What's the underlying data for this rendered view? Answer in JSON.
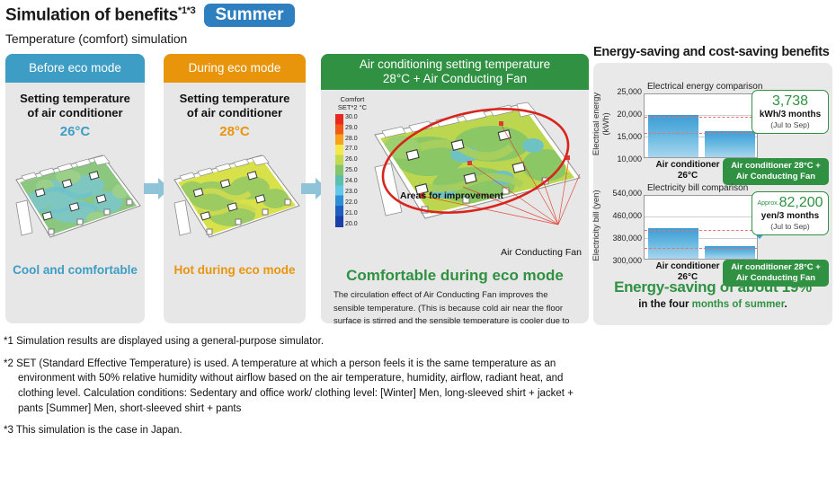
{
  "header": {
    "title": "Simulation of benefits",
    "title_sup": "*1*3",
    "badge": "Summer",
    "subtitle": "Temperature (comfort) simulation"
  },
  "panels": {
    "before": {
      "head": "Before eco mode",
      "set_label": "Setting temperature\nof air conditioner",
      "set_label_line1": "Setting temperature",
      "set_label_line2": "of air conditioner",
      "temp": "26°C",
      "message": "Cool and comfortable",
      "accent": "#3e9dc4"
    },
    "during": {
      "head": "During eco mode",
      "set_label_line1": "Setting temperature",
      "set_label_line2": "of air conditioner",
      "temp": "28°C",
      "message": "Hot during eco mode",
      "accent": "#e8950c"
    },
    "fan": {
      "head_line1": "Air conditioning setting temperature",
      "head_line2": "28°C + Air Conducting Fan",
      "scale_title_line1": "Comfort",
      "scale_title_line2": "SET*2 °C",
      "scale_ticks": [
        "30.0",
        "29.0",
        "28.0",
        "27.0",
        "26.0",
        "25.0",
        "24.0",
        "23.0",
        "22.0",
        "21.0",
        "20.0"
      ],
      "areas_label": "Areas for improvement",
      "fan_caption": "Air Conducting Fan",
      "headline": "Comfortable during eco mode",
      "description": "The circulation effect of Air Conducting Fan improves the sensible temperature. (This is because cold air near the floor surface is stirred and the sensible temperature is cooler due to the blowing)",
      "accent": "#2f9141"
    }
  },
  "right": {
    "title": "Energy-saving and cost-saving benefits",
    "saving_headline": "Energy-saving of about 19%",
    "saving_sub_pre": "in the four ",
    "saving_sub_green": "months of summer",
    "saving_sub_post": "."
  },
  "chart_data": [
    {
      "type": "bar",
      "title": "Electrical energy comparison",
      "ylabel": "Electrical energy (kWh)",
      "xlabel": "",
      "categories": [
        "Air conditioner 26°C",
        "Air conditioner 28°C + Air Conducting Fan"
      ],
      "category_labels": [
        "Air conditioner\n26°C",
        "Air conditioner 28°C +\nAir Conducting Fan"
      ],
      "values": [
        19700,
        15962
      ],
      "ylim": [
        10000,
        25000
      ],
      "ticks": [
        "25,000",
        "20,000",
        "15,000",
        "10,000"
      ],
      "grid": true,
      "reference_lines": [
        19700,
        15962
      ],
      "callout": {
        "approx": "",
        "value": "3,738",
        "unit": "kWh/3 months",
        "period": "(Jul to Sep)"
      }
    },
    {
      "type": "bar",
      "title": "Electricity bill comparison",
      "ylabel": "Electricity bill (yen)",
      "xlabel": "",
      "categories": [
        "Air conditioner 26°C",
        "Air conditioner 28°C + Air Conducting Fan"
      ],
      "category_labels": [
        "Air conditioner\n26°C",
        "Air conditioner 28°C +\nAir Conducting Fan"
      ],
      "values": [
        427000,
        344800
      ],
      "ylim": [
        300000,
        540000
      ],
      "ticks": [
        "540,000",
        "460,000",
        "380,000",
        "300,000"
      ],
      "grid": true,
      "reference_lines": [
        427000,
        344800
      ],
      "callout": {
        "approx": "Approx.",
        "value": "82,200",
        "unit": "yen/3 months",
        "period": "(Jul to Sep)"
      }
    }
  ],
  "footnotes": [
    {
      "line1": "*1 Simulation results are displayed using a general-purpose simulator."
    },
    {
      "line1": "*2 SET (Standard Effective Temperature) is used. A temperature at which a person feels it is the same temperature as an",
      "line2": "environment with 50% relative humidity without airflow based on the air temperature, humidity, airflow, radiant heat, and",
      "line3": "clothing level. Calculation conditions: Sedentary and office work/ clothing level: [Winter] Men, long-sleeved shirt + jacket +",
      "line4": "pants [Summer] Men, short-sleeved shirt + pants"
    },
    {
      "line1": "*3 This simulation is the case in Japan."
    }
  ]
}
